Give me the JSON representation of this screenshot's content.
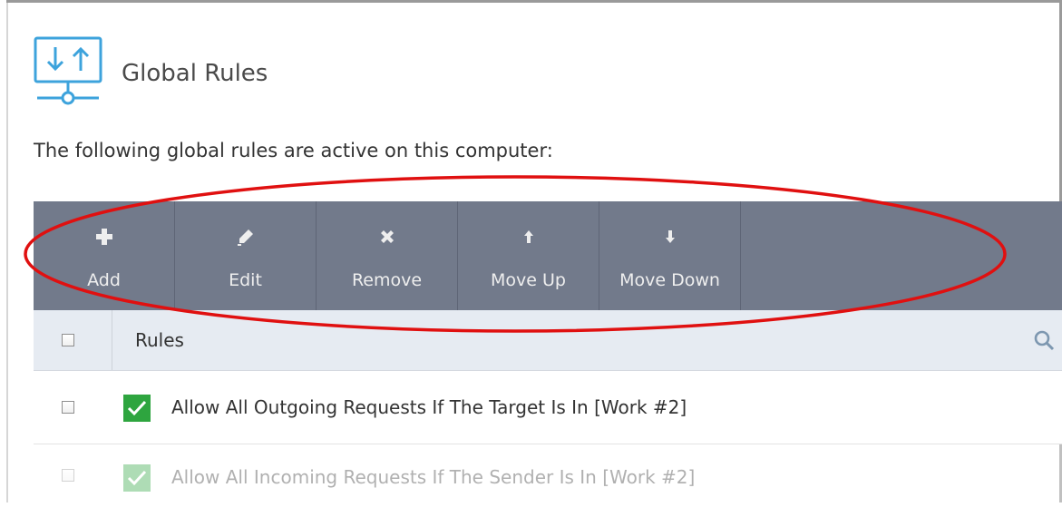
{
  "header": {
    "title": "Global Rules",
    "icon": "network-transfer-icon"
  },
  "subtitle": "The following global rules are active on this computer:",
  "toolbar": {
    "buttons": [
      {
        "label": "Add",
        "icon": "plus-icon"
      },
      {
        "label": "Edit",
        "icon": "pencil-icon"
      },
      {
        "label": "Remove",
        "icon": "x-icon"
      },
      {
        "label": "Move Up",
        "icon": "arrow-up-icon"
      },
      {
        "label": "Move Down",
        "icon": "arrow-down-icon"
      }
    ]
  },
  "table": {
    "column_header": "Rules",
    "rows": [
      {
        "text": "Allow All Outgoing Requests If The Target Is In [Work #2]",
        "status": "enabled"
      },
      {
        "text": "Allow All Incoming Requests If The Sender Is In [Work #2]",
        "status": "enabled"
      }
    ]
  },
  "colors": {
    "toolbar_bg": "#727a8b",
    "header_bg": "#e6ebf2",
    "accent_blue": "#3da3dc",
    "status_green": "#2ea53f",
    "annotation_red": "#e01010"
  }
}
